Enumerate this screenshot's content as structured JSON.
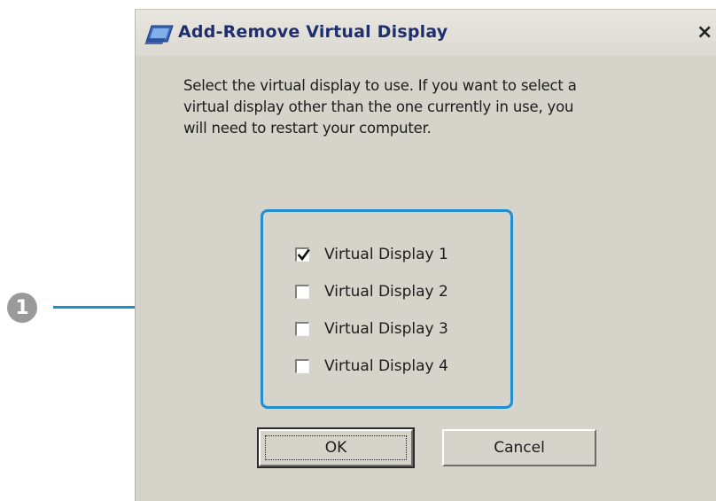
{
  "dialog": {
    "title": "Add-Remove Virtual Display",
    "close_label": "×",
    "title_icon": "virtual-display-icon",
    "message": "Select the virtual display to use. If you want to select a\nvirtual display other than the one currently in use, you\nwill need to restart your computer."
  },
  "displays": [
    {
      "label": "Virtual Display 1",
      "checked": true
    },
    {
      "label": "Virtual Display 2",
      "checked": false
    },
    {
      "label": "Virtual Display 3",
      "checked": false
    },
    {
      "label": "Virtual Display 4",
      "checked": false
    }
  ],
  "buttons": {
    "ok_label": "OK",
    "cancel_label": "Cancel"
  },
  "callout": {
    "number": "1",
    "color": "#1f8fd0"
  }
}
